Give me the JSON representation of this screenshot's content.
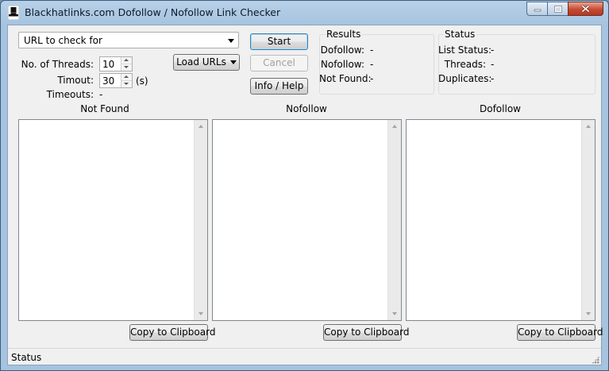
{
  "window": {
    "title": "Blackhatlinks.com Dofollow / Nofollow Link Checker",
    "icon": "top-hat-icon"
  },
  "controls": {
    "url_combo": {
      "value": "URL to check for"
    },
    "threads": {
      "label": "No. of Threads:",
      "value": "10"
    },
    "timeout": {
      "label": "Timout:",
      "value": "30",
      "unit": "(s)"
    },
    "timeouts": {
      "label": "Timeouts:",
      "value": "-"
    },
    "load_urls_label": "Load URLs",
    "start_label": "Start",
    "cancel_label": "Cancel",
    "info_label": "Info / Help"
  },
  "results": {
    "title": "Results",
    "dofollow_label": "Dofollow:",
    "dofollow_value": "-",
    "nofollow_label": "Nofollow:",
    "nofollow_value": "-",
    "notfound_label": "Not Found:",
    "notfound_value": "-"
  },
  "status_group": {
    "title": "Status",
    "list_status_label": "List Status:",
    "list_status_value": "-",
    "threads_label": "Threads:",
    "threads_value": "-",
    "duplicates_label": "Duplicates:",
    "duplicates_value": "-"
  },
  "panels": [
    {
      "header": "Not Found",
      "copy_label": "Copy to Clipboard"
    },
    {
      "header": "Nofollow",
      "copy_label": "Copy to Clipboard"
    },
    {
      "header": "Dofollow",
      "copy_label": "Copy to Clipboard"
    }
  ],
  "statusbar": {
    "text": "Status"
  },
  "colors": {
    "titlebar": "#a6c3df",
    "close_button": "#c74a32",
    "client_bg": "#f0f0f0",
    "default_button_border": "#3c7fb1"
  }
}
